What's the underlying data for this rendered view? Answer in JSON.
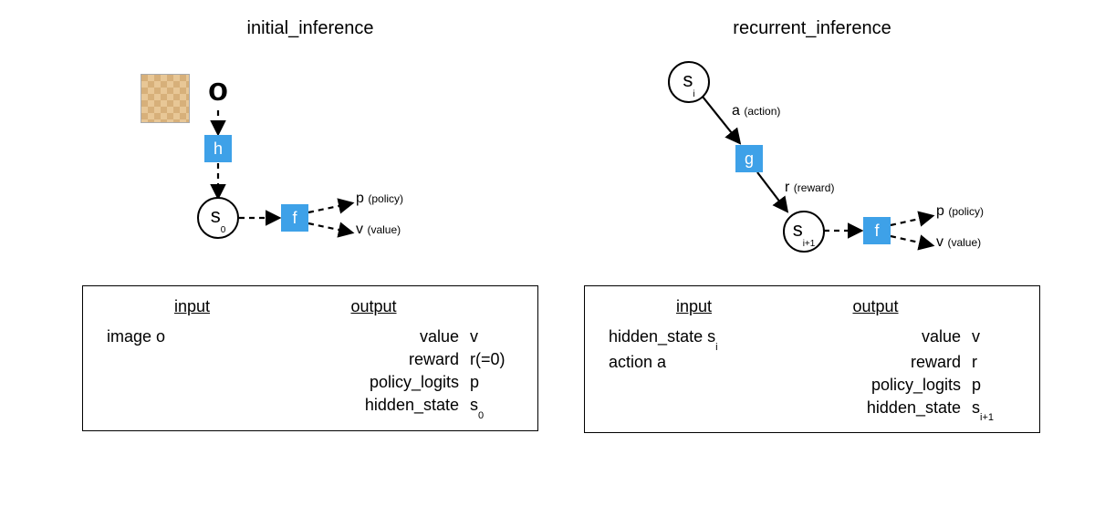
{
  "left": {
    "title": "initial_inference",
    "nodes": {
      "o_symbol": "o",
      "h_box": "h",
      "s0_main": "s",
      "s0_sub": "0",
      "f_box": "f",
      "p_main": "p",
      "p_note": "(policy)",
      "v_main": "v",
      "v_note": "(value)"
    },
    "io": {
      "input_hdr": "input",
      "output_hdr": "output",
      "inputs": [
        {
          "label": "image",
          "sym": "o",
          "sub": ""
        }
      ],
      "outputs": [
        {
          "label": "value",
          "sym": "v",
          "sub": ""
        },
        {
          "label": "reward",
          "sym": "r(=0)",
          "sub": ""
        },
        {
          "label": "policy_logits",
          "sym": "p",
          "sub": ""
        },
        {
          "label": "hidden_state",
          "sym": "s",
          "sub": "0"
        }
      ]
    }
  },
  "right": {
    "title": "recurrent_inference",
    "nodes": {
      "si_main": "s",
      "si_sub": "i",
      "g_box": "g",
      "a_main": "a",
      "a_note": "(action)",
      "r_main": "r",
      "r_note": "(reward)",
      "si1_main": "s",
      "si1_sub": "i+1",
      "f_box": "f",
      "p_main": "p",
      "p_note": "(policy)",
      "v_main": "v",
      "v_note": "(value)"
    },
    "io": {
      "input_hdr": "input",
      "output_hdr": "output",
      "inputs": [
        {
          "label": "hidden_state",
          "sym": "s",
          "sub": "i"
        },
        {
          "label": "action",
          "sym": "a",
          "sub": ""
        }
      ],
      "outputs": [
        {
          "label": "value",
          "sym": "v",
          "sub": ""
        },
        {
          "label": "reward",
          "sym": "r",
          "sub": ""
        },
        {
          "label": "policy_logits",
          "sym": "p",
          "sub": ""
        },
        {
          "label": "hidden_state",
          "sym": "s",
          "sub": "i+1"
        }
      ]
    }
  }
}
